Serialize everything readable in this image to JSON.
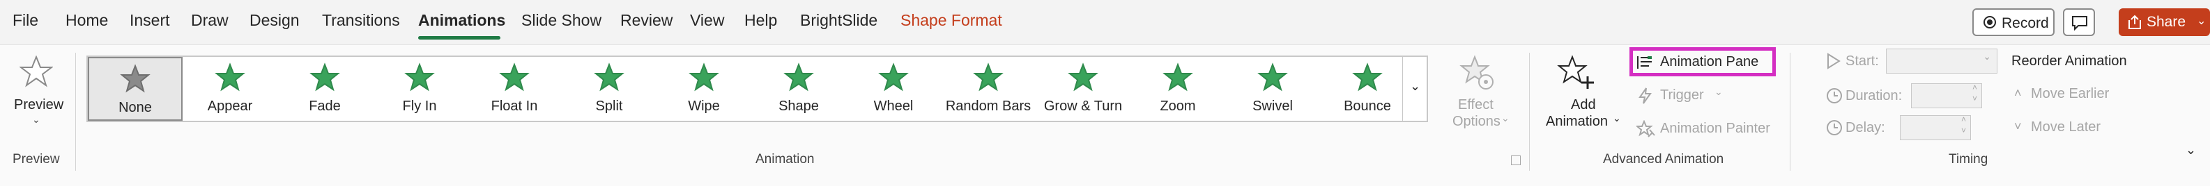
{
  "tabs": [
    "File",
    "Home",
    "Insert",
    "Draw",
    "Design",
    "Transitions",
    "Animations",
    "Slide Show",
    "Review",
    "View",
    "Help",
    "BrightSlide",
    "Shape Format"
  ],
  "active_tab": "Animations",
  "contextual_tab": "Shape Format",
  "title_buttons": {
    "record": "Record",
    "share": "Share"
  },
  "preview": {
    "label": "Preview",
    "group": "Preview"
  },
  "gallery": {
    "items": [
      "None",
      "Appear",
      "Fade",
      "Fly In",
      "Float In",
      "Split",
      "Wipe",
      "Shape",
      "Wheel",
      "Random Bars",
      "Grow & Turn",
      "Zoom",
      "Swivel",
      "Bounce"
    ],
    "selected": "None",
    "effect_options": [
      "Effect",
      "Options"
    ],
    "group": "Animation"
  },
  "advanced": {
    "add_animation": [
      "Add",
      "Animation"
    ],
    "animation_pane": "Animation Pane",
    "trigger": "Trigger",
    "animation_painter": "Animation Painter",
    "group": "Advanced Animation"
  },
  "timing": {
    "start": "Start:",
    "duration": "Duration:",
    "delay": "Delay:",
    "reorder": "Reorder Animation",
    "move_earlier": "Move Earlier",
    "move_later": "Move Later",
    "group": "Timing"
  },
  "colors": {
    "accent": "#1f7b45",
    "share": "#c43e1c",
    "highlight": "#d42ec2",
    "star": "#3aa35b"
  }
}
